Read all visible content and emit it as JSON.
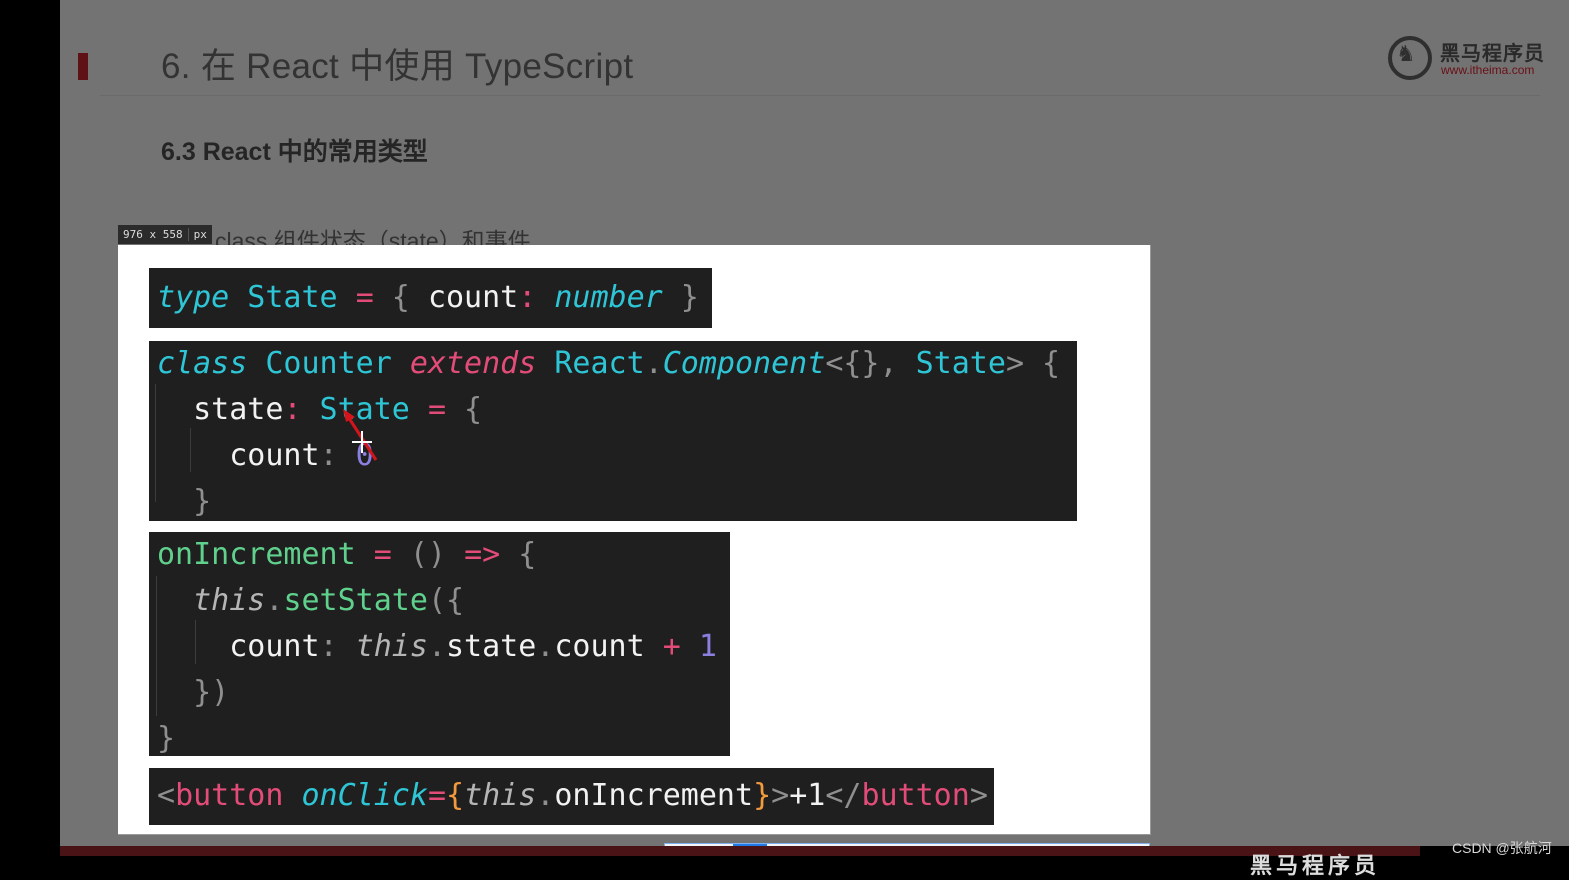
{
  "slide": {
    "title": "6. 在 React 中使用 TypeScript",
    "subtitle": "6.3 React 中的常用类型",
    "section": "class 组件状态（state）和事件",
    "logo": {
      "name": "黑马程序员",
      "url": "www.itheima.com",
      "icon": "horse-logo-icon"
    },
    "accent_color": "#5e1216"
  },
  "screenshot_tool": {
    "dimension_label": "976 x 558",
    "dimension_unit": "px",
    "toolbar": [
      {
        "name": "rectangle-tool",
        "icon": "⧉",
        "active": false
      },
      {
        "name": "line-tool",
        "icon": "〰",
        "active": false
      },
      {
        "name": "arrow-tool",
        "icon": "↗",
        "active": true
      },
      {
        "name": "pen-tool",
        "icon": "✎",
        "active": false
      },
      {
        "name": "highlighter-tool",
        "icon": "✐",
        "active": false
      },
      {
        "name": "mosaic-tool",
        "icon": "▚",
        "active": false
      },
      {
        "name": "text-tool",
        "icon": "T",
        "active": false
      },
      {
        "name": "eraser-tool",
        "icon": "⌫",
        "active": false
      },
      {
        "name": "undo",
        "icon": "↶",
        "active": false
      },
      {
        "name": "redo",
        "icon": "↷",
        "active": false
      },
      {
        "name": "cancel",
        "icon": "✕",
        "active": false
      },
      {
        "name": "pin",
        "icon": "📌",
        "active": false
      },
      {
        "name": "save",
        "icon": "💾",
        "active": false
      },
      {
        "name": "copy",
        "icon": "❐",
        "active": false
      }
    ]
  },
  "code": {
    "type_decl": [
      [
        {
          "t": "type",
          "c": "kw-cyan-i"
        },
        {
          "t": " State ",
          "c": "kw-cyan"
        },
        {
          "t": "=",
          "c": "kw-pink"
        },
        {
          "t": " { ",
          "c": "punc"
        },
        {
          "t": "count",
          "c": "white"
        },
        {
          "t": ":",
          "c": "kw-pink"
        },
        {
          "t": " number",
          "c": "kw-cyan-i"
        },
        {
          "t": " }",
          "c": "punc"
        }
      ]
    ],
    "class_decl": [
      [
        {
          "t": "class",
          "c": "kw-cyan-i"
        },
        {
          "t": " Counter ",
          "c": "kw-cyan"
        },
        {
          "t": "extends",
          "c": "kw-pink-i"
        },
        {
          "t": " React",
          "c": "kw-cyan"
        },
        {
          "t": ".",
          "c": "punc"
        },
        {
          "t": "Component",
          "c": "kw-cyan-i"
        },
        {
          "t": "<{}, ",
          "c": "punc"
        },
        {
          "t": "State",
          "c": "kw-cyan"
        },
        {
          "t": "> {",
          "c": "punc"
        }
      ],
      [
        {
          "t": "  state",
          "c": "white"
        },
        {
          "t": ":",
          "c": "kw-pink"
        },
        {
          "t": " State ",
          "c": "kw-cyan"
        },
        {
          "t": "=",
          "c": "kw-pink"
        },
        {
          "t": " {",
          "c": "punc"
        }
      ],
      [
        {
          "t": "    count",
          "c": "white"
        },
        {
          "t": ":",
          "c": "punc"
        },
        {
          "t": " 0",
          "c": "purple"
        }
      ],
      [
        {
          "t": "  }",
          "c": "punc"
        }
      ]
    ],
    "handler": [
      [
        {
          "t": "onIncrement",
          "c": "green"
        },
        {
          "t": " = ",
          "c": "kw-pink"
        },
        {
          "t": "() ",
          "c": "punc"
        },
        {
          "t": "=>",
          "c": "kw-pink"
        },
        {
          "t": " {",
          "c": "punc"
        }
      ],
      [
        {
          "t": "  this",
          "c": "grey-i"
        },
        {
          "t": ".",
          "c": "punc"
        },
        {
          "t": "setState",
          "c": "green"
        },
        {
          "t": "({",
          "c": "punc"
        }
      ],
      [
        {
          "t": "    count",
          "c": "white"
        },
        {
          "t": ": ",
          "c": "punc"
        },
        {
          "t": "this",
          "c": "grey-i"
        },
        {
          "t": ".",
          "c": "punc"
        },
        {
          "t": "state",
          "c": "white"
        },
        {
          "t": ".",
          "c": "punc"
        },
        {
          "t": "count ",
          "c": "white"
        },
        {
          "t": "+",
          "c": "kw-pink"
        },
        {
          "t": " 1",
          "c": "purple"
        }
      ],
      [
        {
          "t": "  })",
          "c": "punc"
        }
      ],
      [
        {
          "t": "}",
          "c": "punc"
        }
      ]
    ],
    "jsx": [
      [
        {
          "t": "<",
          "c": "punc"
        },
        {
          "t": "button",
          "c": "kw-pink"
        },
        {
          "t": " onClick",
          "c": "kw-cyan-i"
        },
        {
          "t": "=",
          "c": "kw-pink"
        },
        {
          "t": "{",
          "c": "orange"
        },
        {
          "t": "this",
          "c": "grey-i"
        },
        {
          "t": ".",
          "c": "punc"
        },
        {
          "t": "onIncrement",
          "c": "white"
        },
        {
          "t": "}",
          "c": "orange"
        },
        {
          "t": ">",
          "c": "punc"
        },
        {
          "t": "+1",
          "c": "white"
        },
        {
          "t": "</",
          "c": "punc"
        },
        {
          "t": "button",
          "c": "kw-pink"
        },
        {
          "t": ">",
          "c": "punc"
        }
      ]
    ]
  },
  "footer": {
    "brand": "黑马程序员",
    "watermark": "CSDN @张航河"
  }
}
